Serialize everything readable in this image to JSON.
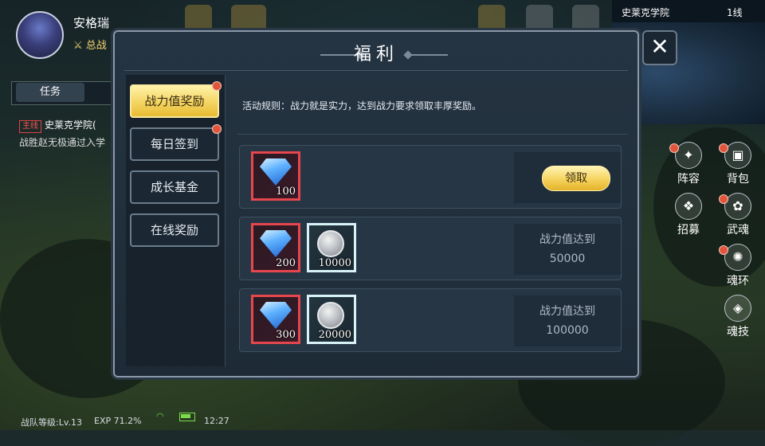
{
  "player": {
    "name": "安格瑞",
    "power_label": "总战"
  },
  "task": {
    "tab_label": "任务",
    "quest_tag": "主线",
    "quest_title": "史莱克学院(",
    "quest_desc": "战胜赵无极通过入学"
  },
  "status_bar": {
    "team_level": "战队等级:Lv.13",
    "exp": "EXP 71.2%",
    "time": "12:27"
  },
  "map": {
    "location": "史莱克学院",
    "line": "1线"
  },
  "side_menu": [
    {
      "label": "阵容"
    },
    {
      "label": "背包"
    },
    {
      "label": "招募"
    },
    {
      "label": "武魂"
    },
    {
      "label": "魂环"
    },
    {
      "label": "魂技"
    }
  ],
  "dialog": {
    "title": "福利",
    "close_symbol": "✕",
    "tabs": [
      {
        "label": "战力值奖励",
        "active": true,
        "badge": true
      },
      {
        "label": "每日签到",
        "active": false,
        "badge": true
      },
      {
        "label": "成长基金",
        "active": false,
        "badge": false
      },
      {
        "label": "在线奖励",
        "active": false,
        "badge": false
      }
    ],
    "rules": "活动规则：战力就是实力，达到战力要求领取丰厚奖励。",
    "rewards": [
      {
        "items": [
          {
            "type": "diamond",
            "qty": "100"
          }
        ],
        "action": "领取"
      },
      {
        "items": [
          {
            "type": "diamond",
            "qty": "200"
          },
          {
            "type": "silver-coin",
            "qty": "10000"
          }
        ],
        "condition_label": "战力值达到",
        "condition_value": "50000"
      },
      {
        "items": [
          {
            "type": "diamond",
            "qty": "300"
          },
          {
            "type": "silver-coin",
            "qty": "20000"
          }
        ],
        "condition_label": "战力值达到",
        "condition_value": "100000"
      }
    ]
  },
  "colors": {
    "active_tab": "#f2d25c",
    "badge": "#e2553d",
    "diamond_frame": "#e6464d",
    "coin_frame": "#d8f3f8"
  }
}
